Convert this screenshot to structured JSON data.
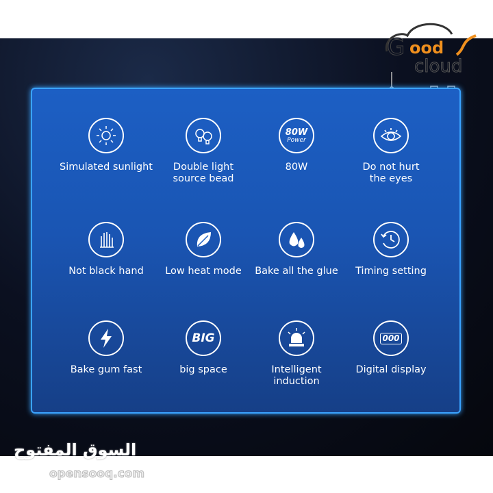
{
  "features": [
    {
      "label": "Simulated sunlight",
      "icon": "sun-icon"
    },
    {
      "label": "Double light source bead",
      "icon": "bulbs-icon"
    },
    {
      "label": "80W",
      "icon": "power-80w-icon",
      "badge": "80W",
      "badge_sub": "Power"
    },
    {
      "label": "Do not hurt the eyes",
      "icon": "eye-icon"
    },
    {
      "label": "Not black hand",
      "icon": "hand-icon"
    },
    {
      "label": "Low heat mode",
      "icon": "leaf-icon"
    },
    {
      "label": "Bake all the glue",
      "icon": "drops-icon"
    },
    {
      "label": "Timing setting",
      "icon": "timer-icon"
    },
    {
      "label": "Bake gum fast",
      "icon": "lightning-icon"
    },
    {
      "label": "big space",
      "icon": "big-icon",
      "badge": "BIG"
    },
    {
      "label": "Intelligent induction",
      "icon": "alarm-light-icon"
    },
    {
      "label": "Digital display",
      "icon": "digital-display-icon",
      "badge": "000"
    }
  ],
  "watermark": {
    "logo": "Goods Cloud",
    "arabic": "السوق المفتوح",
    "site": "opensooq.com"
  },
  "colors": {
    "panel": "#1c5fc4",
    "border": "#3aa3ff",
    "logo_accent": "#f0901e"
  }
}
